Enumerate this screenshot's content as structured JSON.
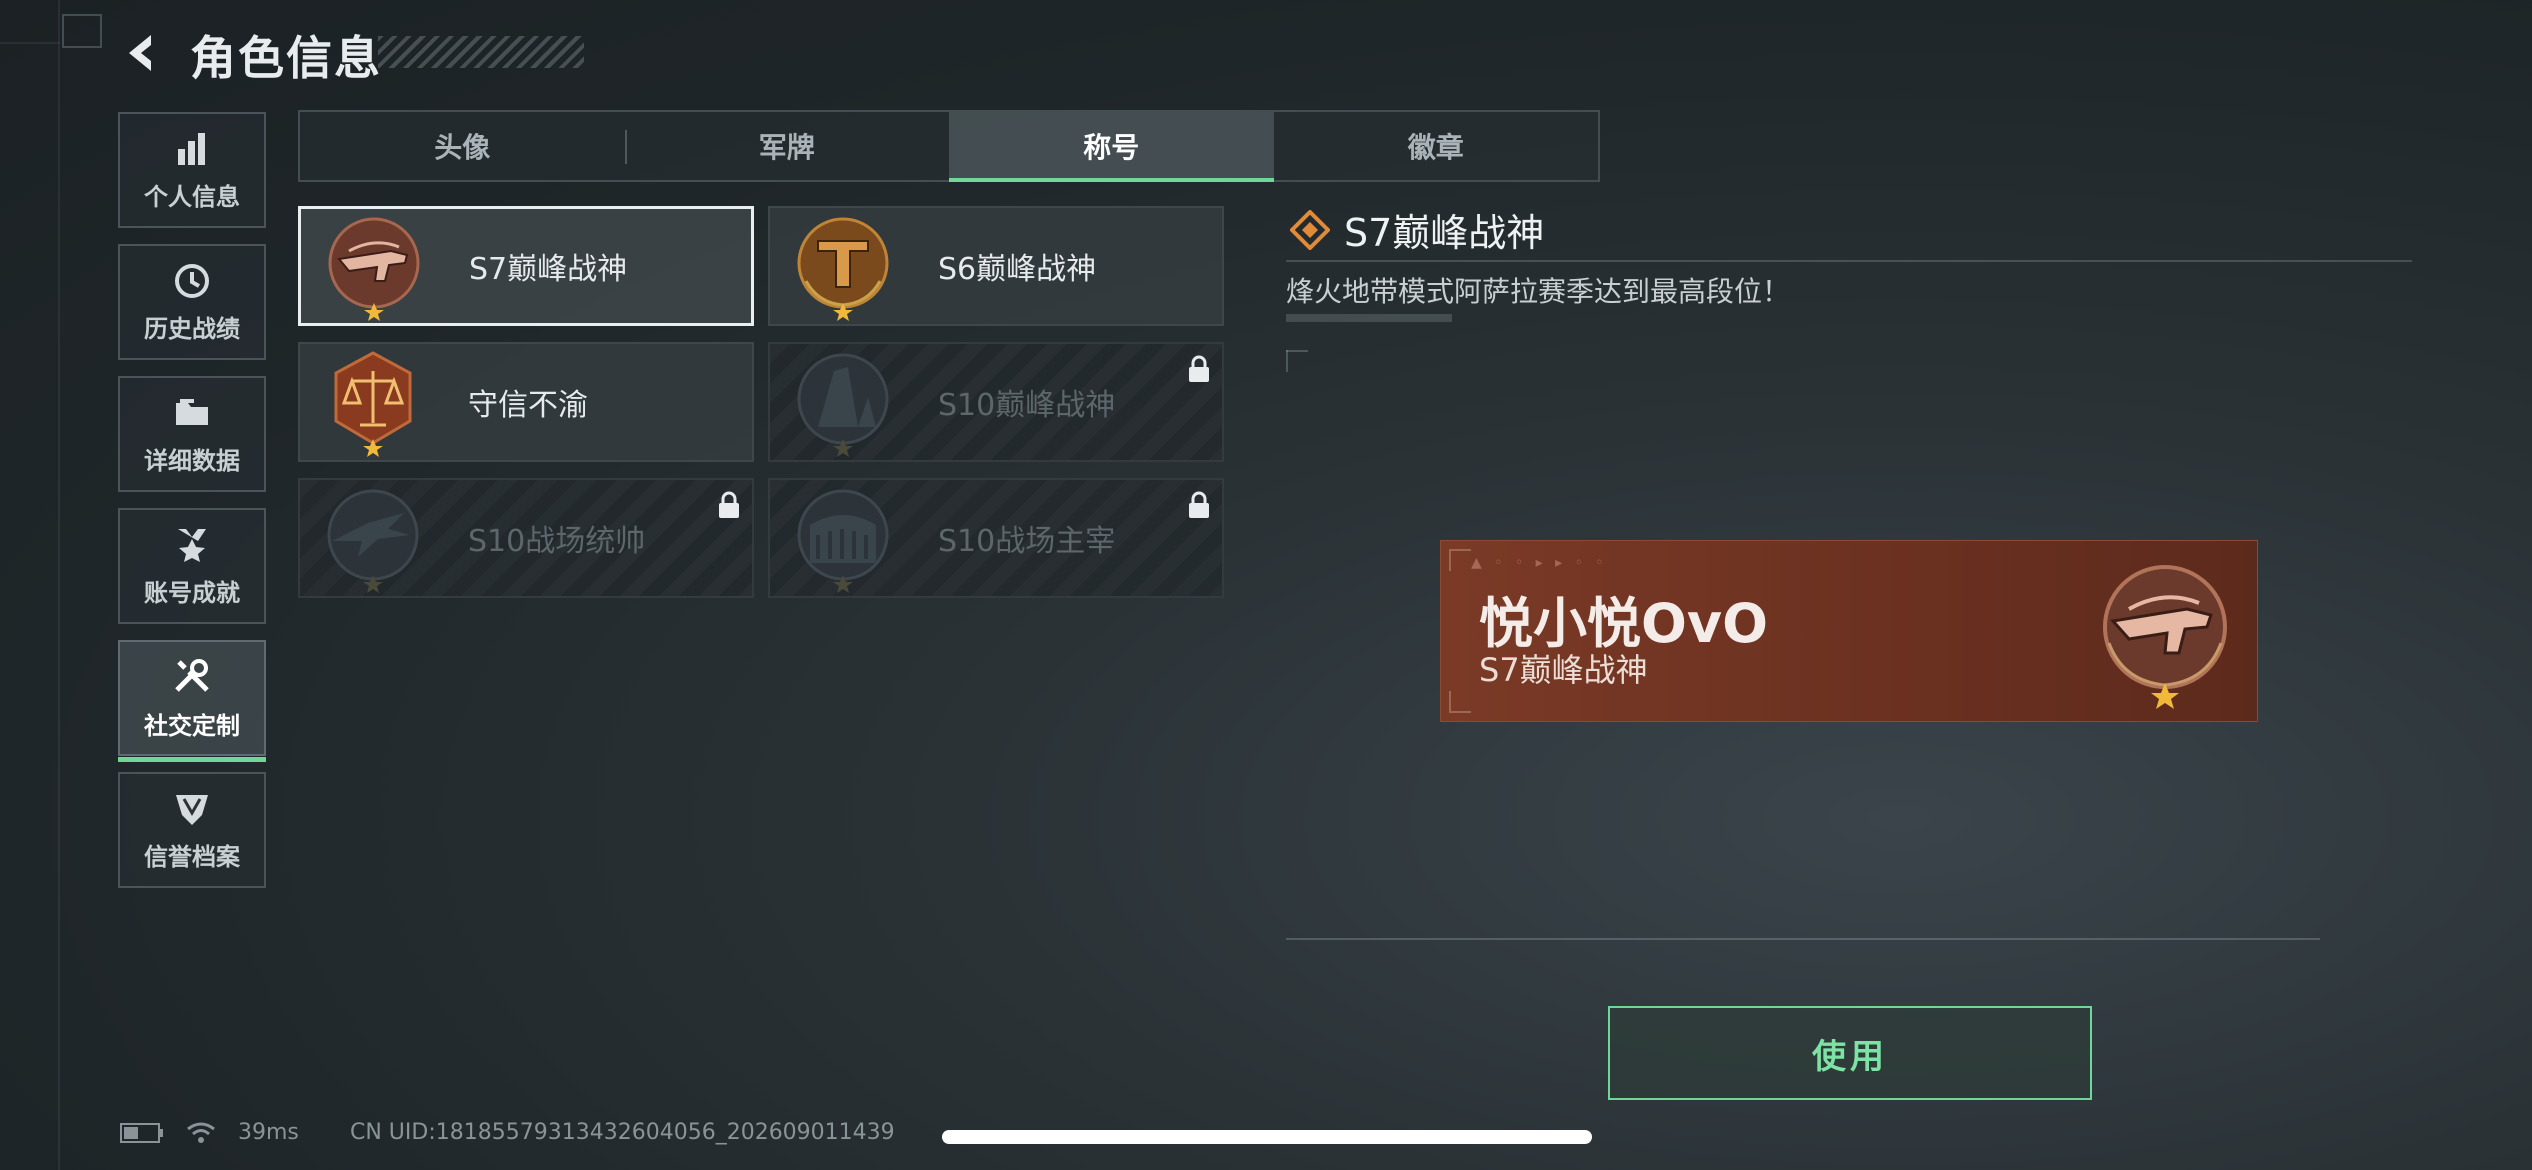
{
  "header": {
    "title": "角色信息"
  },
  "nav": [
    {
      "label": "个人信息",
      "icon": "bar-chart-icon"
    },
    {
      "label": "历史战绩",
      "icon": "clock-icon"
    },
    {
      "label": "详细数据",
      "icon": "folder-icon"
    },
    {
      "label": "账号成就",
      "icon": "medal-icon"
    },
    {
      "label": "社交定制",
      "icon": "tools-icon",
      "active": true
    },
    {
      "label": "信誉档案",
      "icon": "shield-icon"
    }
  ],
  "tabs": [
    {
      "label": "头像"
    },
    {
      "label": "军牌"
    },
    {
      "label": "称号",
      "active": true
    },
    {
      "label": "徽章"
    }
  ],
  "titles": [
    {
      "label": "S7巅峰战神",
      "selected": true,
      "locked": false
    },
    {
      "label": "S6巅峰战神",
      "selected": false,
      "locked": false
    },
    {
      "label": "守信不渝",
      "selected": false,
      "locked": false
    },
    {
      "label": "S10巅峰战神",
      "selected": false,
      "locked": true
    },
    {
      "label": "S10战场统帅",
      "selected": false,
      "locked": true
    },
    {
      "label": "S10战场主宰",
      "selected": false,
      "locked": true
    }
  ],
  "detail": {
    "title": "S7巅峰战神",
    "description": "烽火地带模式阿萨拉赛季达到最高段位！"
  },
  "preview": {
    "player_name": "悦小悦OvO",
    "title": "S7巅峰战神"
  },
  "use_button": {
    "label": "使用"
  },
  "status": {
    "ping": "39ms",
    "uid": "CN UID:18185579313432604056⁩_202609011439"
  },
  "colors": {
    "accent": "#6fd79a",
    "card_bg": "#6a3020"
  }
}
